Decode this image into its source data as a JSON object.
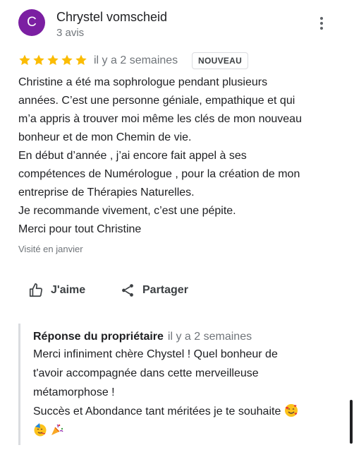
{
  "review": {
    "author_initial": "C",
    "author_name": "Chrystel vomscheid",
    "review_count": "3 avis",
    "rating": 5,
    "date": "il y a 2 semaines",
    "badge": "NOUVEAU",
    "lines": [
      "Christine a été ma sophrologue pendant plusieurs",
      "années. C’est une personne géniale, empathique et qui",
      "m’a appris à trouver moi même les clés de mon nouveau",
      "bonheur et de mon Chemin de vie.",
      "En début d’année , j’ai encore fait appel à ses",
      "compétences de Numérologue , pour la création de mon",
      "entreprise de Thérapies Naturelles.",
      "Je recommande vivement, c’est une pépite.",
      "Merci pour tout Christine"
    ],
    "visited": "Visité en janvier"
  },
  "actions": {
    "like_label": "J'aime",
    "share_label": "Partager"
  },
  "owner_reply": {
    "title": "Réponse du propriétaire",
    "date": "il y a 2 semaines",
    "lines": [
      "Merci infiniment chère Chystel ! Quel bonheur de",
      "t'avoir accompagnée dans cette merveilleuse",
      "métamorphose !",
      "Succès et Abondance tant méritées je te souhaite"
    ],
    "emojis": [
      "smiling-face-with-hearts",
      "partying-face",
      "party-popper"
    ]
  },
  "colors": {
    "avatar": "#7b1fa2",
    "star": "#fbbc04",
    "muted": "#70757a"
  }
}
